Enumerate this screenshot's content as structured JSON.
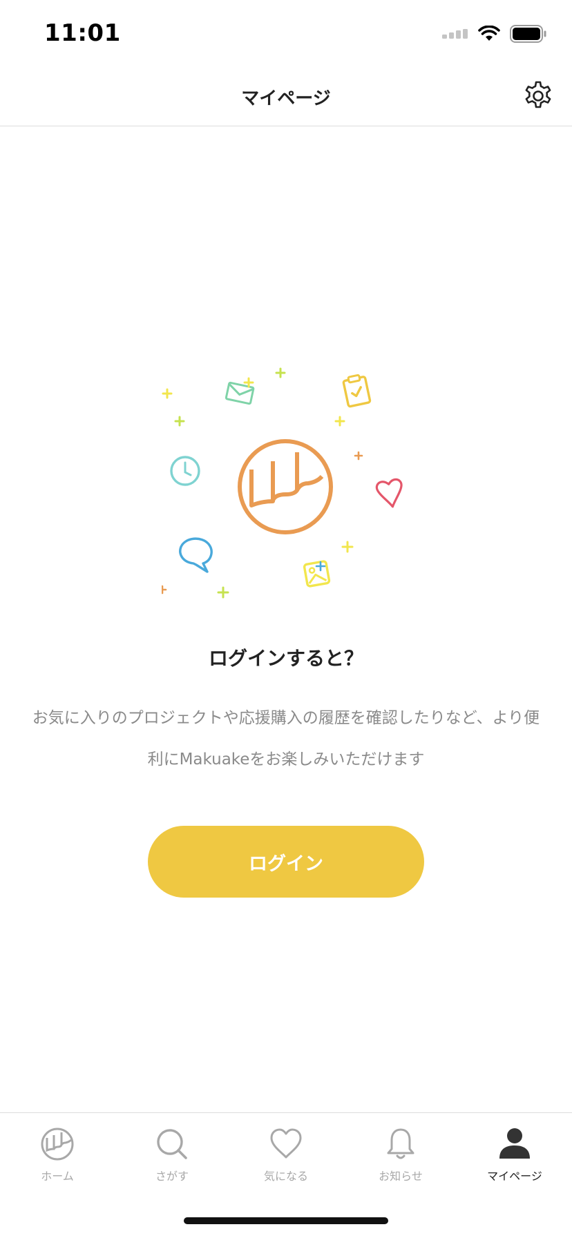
{
  "status_bar": {
    "time": "11:01",
    "icons": [
      "signal-icon",
      "wifi-icon",
      "battery-icon"
    ]
  },
  "header": {
    "title": "マイページ",
    "settings_icon": "gear-icon"
  },
  "main": {
    "illustration_icons": [
      "makuake-logo-icon",
      "envelope-icon",
      "clipboard-check-icon",
      "clock-icon",
      "heart-icon",
      "speech-bubble-icon",
      "image-icon",
      "plus-icon"
    ],
    "headline": "ログインすると？",
    "description": "お気に入りのプロジェクトや応援購入の履歴を確認したりなど、より便利にMakuakeをお楽しみいただけます",
    "login_label": "ログイン"
  },
  "tab_bar": {
    "tabs": [
      {
        "label": "ホーム",
        "icon": "makuake-home-icon",
        "active": false
      },
      {
        "label": "さがす",
        "icon": "search-icon",
        "active": false
      },
      {
        "label": "気になる",
        "icon": "heart-icon",
        "active": false
      },
      {
        "label": "お知らせ",
        "icon": "bell-icon",
        "active": false
      },
      {
        "label": "マイページ",
        "icon": "person-icon",
        "active": true
      }
    ]
  },
  "colors": {
    "accent": "#efc842",
    "logo_orange": "#e99b52",
    "text_primary": "#222222",
    "text_secondary": "#8a8a8a",
    "tab_inactive": "#a8a8a8"
  }
}
